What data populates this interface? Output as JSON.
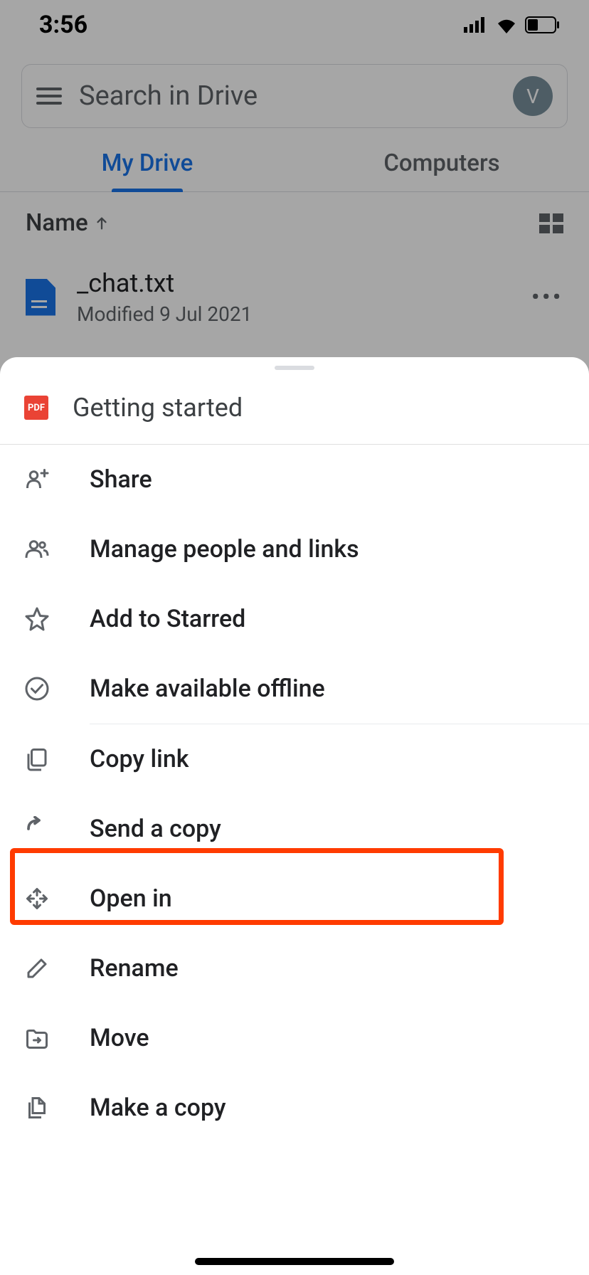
{
  "status_bar": {
    "time": "3:56"
  },
  "search": {
    "placeholder": "Search in Drive",
    "avatar_initial": "V"
  },
  "tabs": {
    "my_drive": "My Drive",
    "computers": "Computers"
  },
  "sort": {
    "label": "Name"
  },
  "file": {
    "name": "_chat.txt",
    "meta": "Modified 9 Jul 2021"
  },
  "sheet": {
    "title": "Getting started",
    "items": {
      "share": "Share",
      "manage": "Manage people and links",
      "star": "Add to Starred",
      "offline": "Make available offline",
      "copy_link": "Copy link",
      "send_copy": "Send a copy",
      "open_in": "Open in",
      "rename": "Rename",
      "move": "Move",
      "make_copy": "Make a copy"
    }
  }
}
